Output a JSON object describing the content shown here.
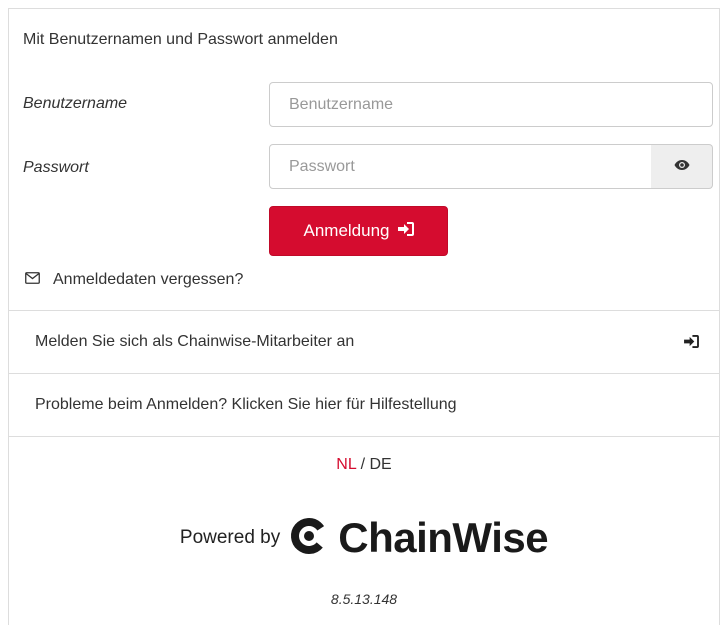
{
  "login": {
    "heading": "Mit Benutzernamen und Passwort anmelden",
    "username_label": "Benutzername",
    "username_placeholder": "Benutzername",
    "username_value": "",
    "password_label": "Passwort",
    "password_placeholder": "Passwort",
    "password_value": "",
    "submit_label": "Anmeldung",
    "forgot_label": "Anmeldedaten vergessen?"
  },
  "employee_login": {
    "label": "Melden Sie sich als Chainwise-Mitarbeiter an"
  },
  "help": {
    "label": "Probleme beim Anmelden? Klicken Sie hier für Hilfestellung"
  },
  "language": {
    "nl": "NL",
    "separator": " / ",
    "de": "DE"
  },
  "footer": {
    "powered_by": "Powered by",
    "brand": "ChainWise",
    "version": "8.5.13.148"
  },
  "colors": {
    "accent": "#d50c2f",
    "border": "#dddddd",
    "text": "#333333"
  },
  "icons": [
    "eye-icon",
    "sign-in-icon",
    "envelope-icon",
    "chainwise-logo-icon"
  ]
}
